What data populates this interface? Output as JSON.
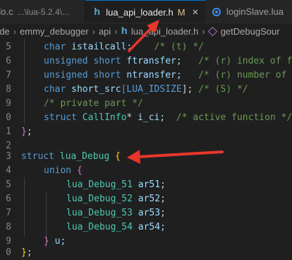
{
  "tabs": [
    {
      "prefix": "do.c",
      "path": "...\\lua-5.2.4\\...",
      "active": false
    },
    {
      "icon": "h",
      "label": "lua_api_loader.h",
      "modified": "M",
      "close": "×",
      "active": true
    },
    {
      "label": "loginSlave.lua",
      "active": false
    }
  ],
  "breadcrumb": {
    "items": [
      "ude",
      "emmy_debugger",
      "api"
    ],
    "file_icon": "h",
    "file": "lua_api_loader.h",
    "symbol": "getDebugSour"
  },
  "gutter": {
    "line_numbers": [
      "5",
      "6",
      "7",
      "8",
      "9",
      "0",
      "1",
      "2",
      "3",
      "4",
      "5",
      "6",
      "7",
      "8",
      "9",
      "0"
    ]
  },
  "code": {
    "l1_type": "char",
    "l1_name": "istailcall;",
    "l1_comment": "/* (t) */",
    "l2_type1": "unsigned",
    "l2_type2": "short",
    "l2_name": "ftransfer;",
    "l2_comment": "/* (r) index of fi",
    "l3_type1": "unsigned",
    "l3_type2": "short",
    "l3_name": "ntransfer;",
    "l3_comment": "/* (r) number of t",
    "l4_type": "char",
    "l4_name": "short_src",
    "l4_open": "[",
    "l4_const": "LUA_IDSIZE",
    "l4_close": "];",
    "l4_comment": "/* (S) */",
    "l5_comment": "/* private part */",
    "l6_kw": "struct",
    "l6_type": "CallInfo",
    "l6_ptr": "* ",
    "l6_name": "i_ci;",
    "l6_comment": "/* active function */",
    "l7_close": "}",
    "l7_semi": ";",
    "l9_kw": "struct",
    "l9_name": "lua_Debug",
    "l9_open": "{",
    "l10_kw": "union",
    "l10_open": "{",
    "members": [
      {
        "type": "lua_Debug_51",
        "name": "ar51;"
      },
      {
        "type": "lua_Debug_52",
        "name": "ar52;"
      },
      {
        "type": "lua_Debug_53",
        "name": "ar53;"
      },
      {
        "type": "lua_Debug_54",
        "name": "ar54;"
      }
    ],
    "l15_close": "}",
    "l15_name": "u;",
    "l16_close": "}",
    "l16_semi": ";"
  },
  "colors": {
    "background": "#1f1f1f",
    "keyword": "#569cd6",
    "type": "#4ec9b0",
    "identifier": "#9cdcfe",
    "comment": "#6a9955",
    "annotation_arrow": "#e8362a"
  }
}
